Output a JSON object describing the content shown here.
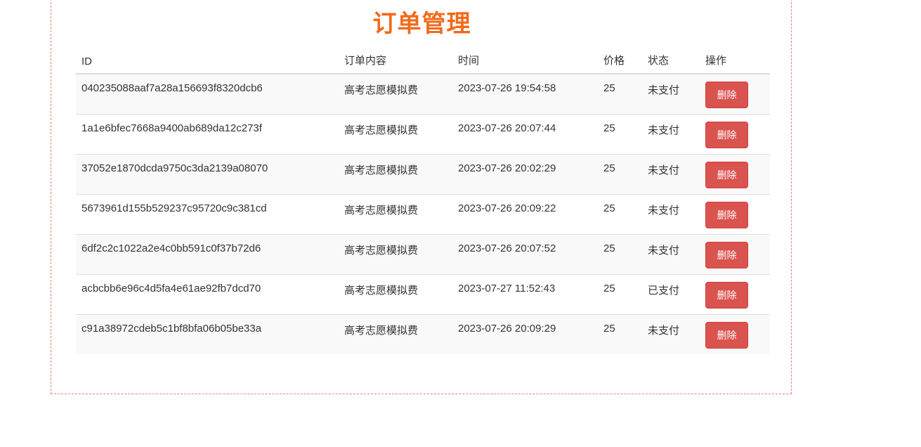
{
  "page": {
    "title": "订单管理"
  },
  "table": {
    "headers": {
      "id": "ID",
      "content": "订单内容",
      "time": "时间",
      "price": "价格",
      "status": "状态",
      "action": "操作"
    },
    "rows": [
      {
        "id": "040235088aaf7a28a156693f8320dcb6",
        "content": "高考志愿模拟费",
        "time": "2023-07-26 19:54:58",
        "price": "25",
        "status": "未支付",
        "action": "删除"
      },
      {
        "id": "1a1e6bfec7668a9400ab689da12c273f",
        "content": "高考志愿模拟费",
        "time": "2023-07-26 20:07:44",
        "price": "25",
        "status": "未支付",
        "action": "删除"
      },
      {
        "id": "37052e1870dcda9750c3da2139a08070",
        "content": "高考志愿模拟费",
        "time": "2023-07-26 20:02:29",
        "price": "25",
        "status": "未支付",
        "action": "删除"
      },
      {
        "id": "5673961d155b529237c95720c9c381cd",
        "content": "高考志愿模拟费",
        "time": "2023-07-26 20:09:22",
        "price": "25",
        "status": "未支付",
        "action": "删除"
      },
      {
        "id": "6df2c2c1022a2e4c0bb591c0f37b72d6",
        "content": "高考志愿模拟费",
        "time": "2023-07-26 20:07:52",
        "price": "25",
        "status": "未支付",
        "action": "删除"
      },
      {
        "id": "acbcbb6e96c4d5fa4e61ae92fb7dcd70",
        "content": "高考志愿模拟费",
        "time": "2023-07-27 11:52:43",
        "price": "25",
        "status": "已支付",
        "action": "删除"
      },
      {
        "id": "c91a38972cdeb5c1bf8bfa06b05be33a",
        "content": "高考志愿模拟费",
        "time": "2023-07-26 20:09:29",
        "price": "25",
        "status": "未支付",
        "action": "删除"
      }
    ]
  },
  "colors": {
    "title": "#f26a1b",
    "delete_button": "#d9534f",
    "panel_border": "#e9827a"
  }
}
